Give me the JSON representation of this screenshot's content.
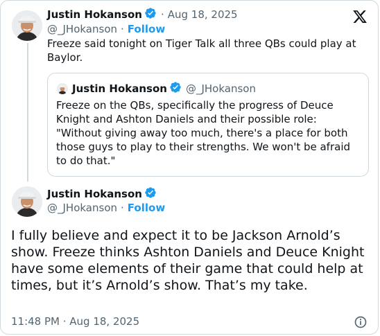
{
  "first_tweet": {
    "author_name": "Justin Hokanson",
    "handle": "@_JHokanson",
    "separator": "·",
    "date": "Aug 18, 2025",
    "follow_label": "Follow",
    "text": "Freeze said tonight on Tiger Talk all three QBs could play at Baylor."
  },
  "quoted_tweet": {
    "author_name": "Justin Hokanson",
    "handle": "@_JHokanson",
    "text": "Freeze on the QBs, specifically the progress of Deuce Knight and Ashton Daniels and their possible role: \"Without giving away too much, there's a place for both those guys to play to their strengths. We won't be afraid to do that.\""
  },
  "main_tweet": {
    "author_name": "Justin Hokanson",
    "handle": "@_JHokanson",
    "separator": "·",
    "follow_label": "Follow",
    "text": "I fully believe and expect it to be Jackson Arnold’s show. Freeze thinks Ashton Daniels and Deuce Knight have some elements of their game that could help at times, but it’s Arnold’s show. That’s my take.",
    "timestamp": "11:48 PM · Aug 18, 2025"
  },
  "icons": {
    "logo": "x-logo-icon",
    "verified": "verified-badge-icon",
    "info": "info-icon"
  },
  "colors": {
    "accent": "#1d9bf0",
    "text": "#0f1419",
    "secondary": "#536471",
    "border": "#cfd9de"
  }
}
